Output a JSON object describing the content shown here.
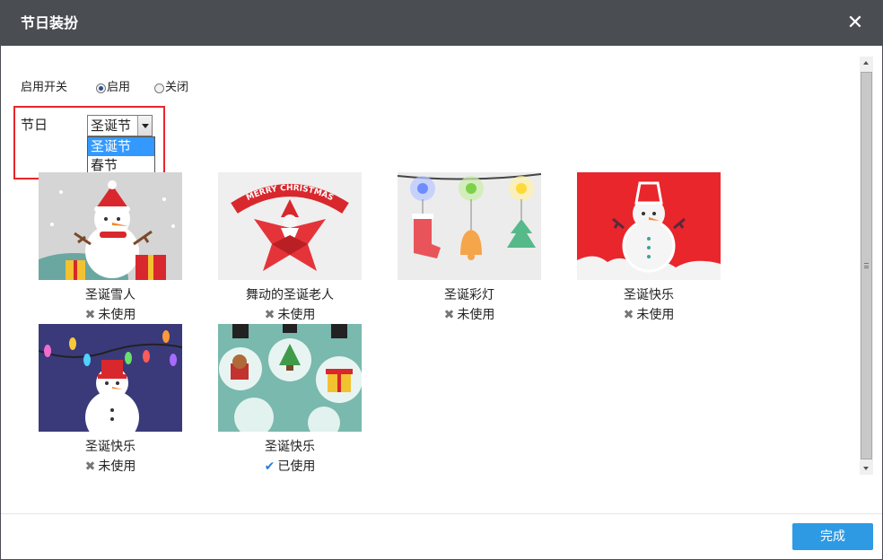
{
  "dialog": {
    "title": "节日装扮",
    "close_glyph": "✕"
  },
  "switch": {
    "label": "启用开关",
    "options": [
      {
        "label": "启用",
        "checked": true
      },
      {
        "label": "关闭",
        "checked": false
      }
    ]
  },
  "holiday": {
    "label": "节日",
    "selected": "圣诞节",
    "options": [
      "圣诞节",
      "春节"
    ]
  },
  "themes": [
    {
      "name": "圣诞雪人",
      "status": "未使用",
      "used": false,
      "icon": "snowman-red-hat-icon"
    },
    {
      "name": "舞动的圣诞老人",
      "status": "未使用",
      "used": false,
      "icon": "dancing-santa-icon",
      "banner": "MERRY CHRISTMAS"
    },
    {
      "name": "圣诞彩灯",
      "status": "未使用",
      "used": false,
      "icon": "christmas-lights-icon"
    },
    {
      "name": "圣诞快乐",
      "status": "未使用",
      "used": false,
      "icon": "snowman-red-background-icon"
    },
    {
      "name": "圣诞快乐",
      "status": "未使用",
      "used": false,
      "icon": "snowman-string-lights-icon"
    },
    {
      "name": "圣诞快乐",
      "status": "已使用",
      "used": true,
      "icon": "christmas-bulbs-icon"
    }
  ],
  "status_icons": {
    "unused": "✖",
    "used": "✔"
  },
  "colors": {
    "titlebar": "#4a4d52",
    "accent": "#2d9ae3",
    "highlight": "#e8262b",
    "check": "#2d7fdc"
  },
  "footer": {
    "done_label": "完成"
  }
}
